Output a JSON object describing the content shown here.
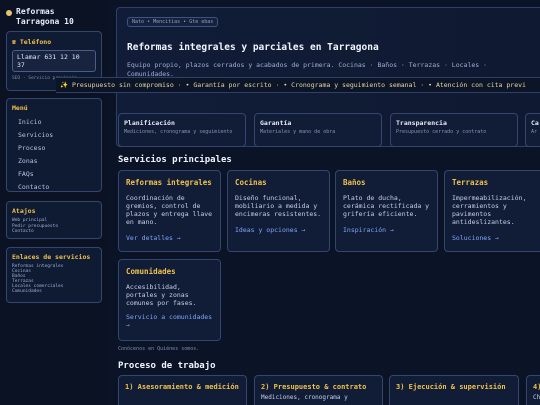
{
  "sidebar": {
    "brand": "Reformas Tarragona 10",
    "phone": {
      "title": "☎ Teléfono",
      "button": "Llamar 631 12 10 37",
      "note": "SEO · Servicio provincia"
    },
    "menu": {
      "title": "Menú",
      "items": [
        "Inicio",
        "Servicios",
        "Proceso",
        "Zonas",
        "FAQs",
        "Contacto"
      ]
    },
    "atajos": {
      "title": "Atajos",
      "items": [
        "Web principal",
        "Pedir presupuesto",
        "Contacto"
      ]
    },
    "enlaces": {
      "title": "Enlaces de servicios",
      "items": [
        "Reformas integrales",
        "Cocinas",
        "Baños",
        "Terrazas",
        "Locales comerciales",
        "Comunidades"
      ]
    }
  },
  "hero": {
    "breadcrumb": "Nato • Mencitias • Gte ebas",
    "title": "Reformas integrales y parciales en Tarragona",
    "description": "Equipo propio, plazos cerrados y acabados de primera. Cocinas · Baños · Terrazas · Locales · Comunidades."
  },
  "ticker": "✨ Presupuesto sin compromiso · • Garantía por escrito · • Cronograma y seguimiento semanal · • Atención con cita previ",
  "features": [
    {
      "title": "Planificación",
      "desc": "Mediciones, cronograma y seguimiento"
    },
    {
      "title": "Garantía",
      "desc": "Materiales y mano de obra"
    },
    {
      "title": "Transparencia",
      "desc": "Presupuesto cerrado y contrato"
    },
    {
      "title": "Ca",
      "desc": "Ar"
    }
  ],
  "services_section": {
    "title": "Servicios principales",
    "items": [
      {
        "title": "Reformas integrales",
        "desc": "Coordinación de gremios, control de plazos y entrega llave en mano.",
        "link": "Ver detalles →"
      },
      {
        "title": "Cocinas",
        "desc": "Diseño funcional, mobiliario a medida y encimeras resistentes.",
        "link": "Ideas y opciones →"
      },
      {
        "title": "Baños",
        "desc": "Plato de ducha, cerámica rectificada y grifería eficiente.",
        "link": "Inspiración →"
      },
      {
        "title": "Terrazas",
        "desc": "Impermeabilización, cerramientos y pavimentos antideslizantes.",
        "link": "Soluciones →"
      },
      {
        "title": "Comunidades",
        "desc": "Accesibilidad, portales y zonas comunes por fases.",
        "link": "Servicio a comunidades →"
      }
    ],
    "footnote": "Conócenos en Quiénes somos."
  },
  "process_section": {
    "title": "Proceso de trabajo",
    "steps": [
      {
        "title": "1) Asesoramiento & medición",
        "desc": ""
      },
      {
        "title": "2) Presupuesto & contrato",
        "desc": "Mediciones, cronograma y"
      },
      {
        "title": "3) Ejecución & supervisión",
        "desc": ""
      },
      {
        "title": "4)",
        "desc": "Ch"
      }
    ]
  }
}
